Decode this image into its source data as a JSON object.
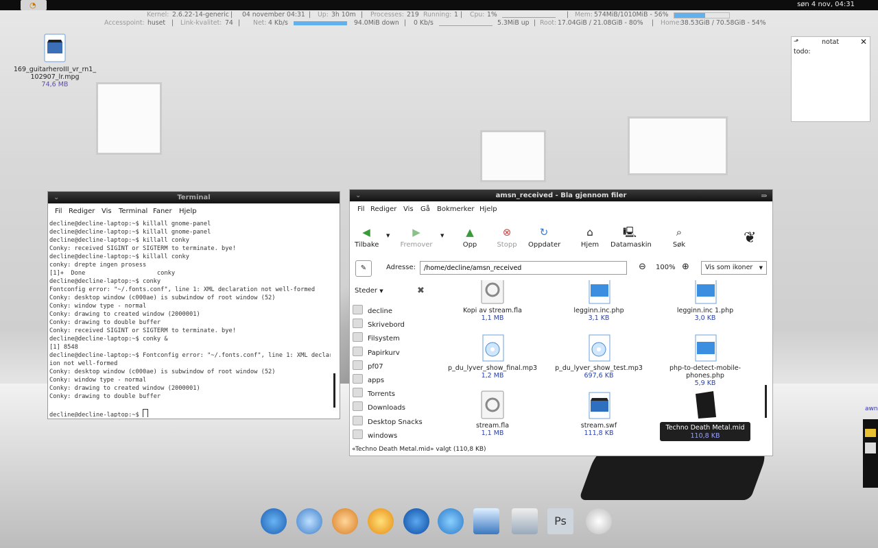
{
  "top_panel": {
    "clock": "søn  4 nov, 04:31"
  },
  "conky": {
    "kernel_label": "Kernel:",
    "kernel": "2.6.22-14-generic",
    "date": "04 november 04:31",
    "up_label": "Up:",
    "up": "3h 10m",
    "processes_label": "Processes:",
    "processes": "219",
    "running_label": "Running:",
    "running": "1",
    "cpu_label": "Cpu:",
    "cpu": "1%",
    "mem_label": "Mem:",
    "mem": "574MiB/1010MiB - 56%",
    "mem_fraction": 0.56,
    "ap_label": "Accesspoint:",
    "ap": "huset",
    "link_label": "Link-kvalitet:",
    "link": "74",
    "net_label": "Net:",
    "net_down_rate": "4 Kb/s",
    "net_down_total": "94.0MiB down",
    "net_up_rate": "0 Kb/s",
    "net_up_total": "5.3MiB up",
    "root_label": "Root:",
    "root": "17.04GiB  / 21.08GiB - 80%",
    "home_label": "Home:",
    "home": "38.53GiB  / 70.58GiB - 54%"
  },
  "desktop_icon": {
    "name_line1": "169_guitarheroIII_vr_rn1_",
    "name_line2": "102907_lr.mpg",
    "size": "74,6 MB"
  },
  "note": {
    "title": "notat",
    "body": "todo:"
  },
  "terminal": {
    "title": "Terminal",
    "menu": [
      "Fil",
      "Rediger",
      "Vis",
      "Terminal",
      "Faner",
      "Hjelp"
    ],
    "lines": [
      "decline@decline-laptop:~$ killall gnome-panel",
      "decline@decline-laptop:~$ killall gnome-panel",
      "decline@decline-laptop:~$ killall conky",
      "Conky: received SIGINT or SIGTERM to terminate. bye!",
      "decline@decline-laptop:~$ killall conky",
      "conky: drepte ingen prosess",
      "[1]+  Done                    conky",
      "decline@decline-laptop:~$ conky",
      "Fontconfig error: \"~/.fonts.conf\", line 1: XML declaration not well-formed",
      "Conky: desktop window (c000ae) is subwindow of root window (52)",
      "Conky: window type - normal",
      "Conky: drawing to created window (2000001)",
      "Conky: drawing to double buffer",
      "Conky: received SIGINT or SIGTERM to terminate. bye!",
      "decline@decline-laptop:~$ conky &",
      "[1] 8548",
      "decline@decline-laptop:~$ Fontconfig error: \"~/.fonts.conf\", line 1: XML declarat",
      "ion not well-formed",
      "Conky: desktop window (c000ae) is subwindow of root window (52)",
      "Conky: window type - normal",
      "Conky: drawing to created window (2000001)",
      "Conky: drawing to double buffer",
      "",
      "decline@decline-laptop:~$ "
    ]
  },
  "file_manager": {
    "title": "amsn_received - Bla gjennom filer",
    "menu": [
      "Fil",
      "Rediger",
      "Vis",
      "Gå",
      "Bokmerker",
      "Hjelp"
    ],
    "toolbar": {
      "back": "Tilbake",
      "forward": "Fremover",
      "up": "Opp",
      "stop": "Stopp",
      "reload": "Oppdater",
      "home": "Hjem",
      "computer": "Datamaskin",
      "search": "Søk"
    },
    "address_label": "Adresse:",
    "address": "/home/decline/amsn_received",
    "zoom": "100%",
    "view_mode": "Vis som ikoner",
    "sidebar_title": "Steder",
    "places": [
      "decline",
      "Skrivebord",
      "Filsystem",
      "Papirkurv",
      "pf07",
      "apps",
      "Torrents",
      "Downloads",
      "Desktop Snacks",
      "windows"
    ],
    "files": [
      {
        "name1": "Kopi av stream.fla",
        "name2": "",
        "size": "1,1 MB"
      },
      {
        "name1": "legginn.inc.php",
        "name2": "",
        "size": "3,1 KB"
      },
      {
        "name1": "legginn.inc 1.php",
        "name2": "",
        "size": "3,0 KB"
      },
      {
        "name1": "p_du_lyver_show_final.mp3",
        "name2": "",
        "size": "1,2 MB"
      },
      {
        "name1": "p_du_lyver_show_test.mp3",
        "name2": "",
        "size": "697,6 KB"
      },
      {
        "name1": "php-to-detect-mobile-",
        "name2": "phones.php",
        "size": "5,9 KB"
      },
      {
        "name1": "stream.fla",
        "name2": "",
        "size": "1,1 MB"
      },
      {
        "name1": "stream.swf",
        "name2": "",
        "size": "111,8 KB"
      },
      {
        "name1": "Techno Death Metal.mid",
        "name2": "",
        "size": "110,8 KB"
      }
    ],
    "status": "«Techno Death Metal.mid» valgt (110,8 KB)"
  },
  "right_panel": {
    "label": "awn"
  },
  "colors": {
    "accent": "#63b1ec",
    "selection": "#1f1f1f",
    "size_text": "#2a3fa8"
  }
}
